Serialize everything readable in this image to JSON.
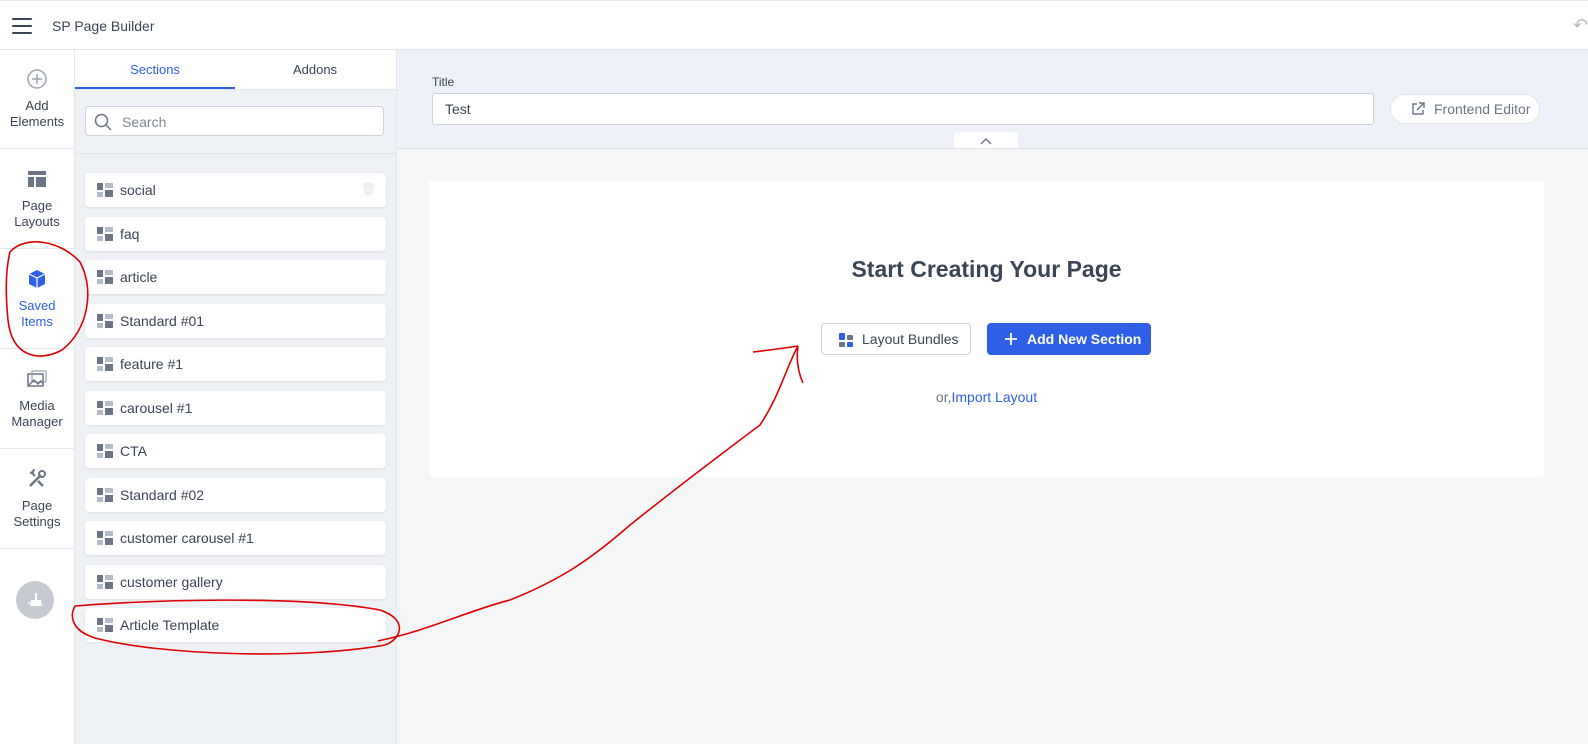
{
  "app": {
    "title": "SP Page Builder"
  },
  "nav": {
    "add_elements": "Add Elements",
    "page_layouts": "Page Layouts",
    "saved_items": "Saved Items",
    "media_manager": "Media Manager",
    "page_settings": "Page Settings"
  },
  "panel": {
    "tabs": [
      "Sections",
      "Addons"
    ],
    "search_placeholder": "Search",
    "items": [
      "social",
      "faq",
      "article",
      "Standard #01",
      "feature #1",
      "carousel #1",
      "CTA",
      "Standard #02",
      "customer carousel #1",
      "customer gallery",
      "Article Template"
    ]
  },
  "main": {
    "title_label": "Title",
    "title_value": "Test",
    "frontend_editor": "Frontend Editor",
    "heading": "Start Creating Your Page",
    "layout_bundles": "Layout Bundles",
    "add_new_section": "Add New Section",
    "or_text": "or,",
    "import_layout": "Import Layout"
  },
  "colors": {
    "accent": "#2f5fe6",
    "annotation": "#e00000"
  }
}
